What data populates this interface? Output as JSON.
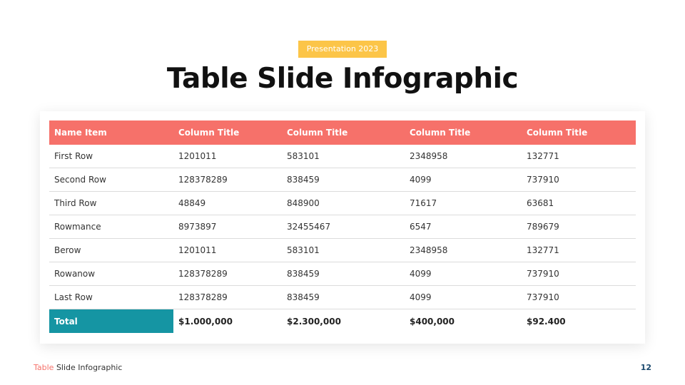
{
  "badge": "Presentation 2023",
  "title": "Table Slide Infographic",
  "table": {
    "headers": [
      "Name Item",
      "Column Title",
      "Column Title",
      "Column Title",
      "Column Title"
    ],
    "rows": [
      [
        "First Row",
        "1201011",
        "583101",
        "2348958",
        "132771"
      ],
      [
        "Second Row",
        "128378289",
        "838459",
        "4099",
        "737910"
      ],
      [
        "Third Row",
        "48849",
        "848900",
        "71617",
        "63681"
      ],
      [
        "Rowmance",
        "8973897",
        "32455467",
        "6547",
        "789679"
      ],
      [
        "Berow",
        "1201011",
        "583101",
        "2348958",
        "132771"
      ],
      [
        "Rowanow",
        "128378289",
        "838459",
        "4099",
        "737910"
      ],
      [
        "Last Row",
        "128378289",
        "838459",
        "4099",
        "737910"
      ]
    ],
    "total": [
      "Total",
      "$1.000,000",
      "$2.300,000",
      "$400,000",
      "$92.400"
    ]
  },
  "footer": {
    "accent": "Table",
    "rest": " Slide Infographic",
    "page_number": "12"
  },
  "colors": {
    "header_bg": "#f6716a",
    "total_bg": "#1595a3",
    "badge_bg": "#fcc548",
    "page_number": "#1c4a6e"
  }
}
